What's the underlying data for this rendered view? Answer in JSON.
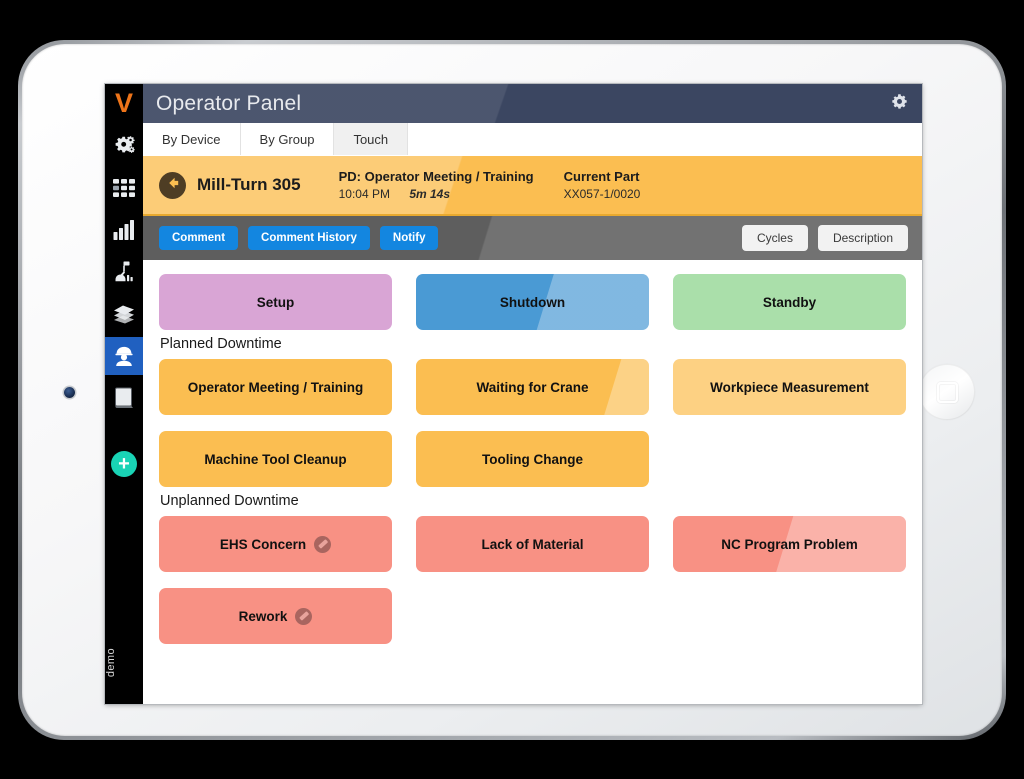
{
  "device": {
    "home_button_icon": "home-square-icon",
    "camera_icon": "front-camera-dot"
  },
  "sidebar": {
    "logo_text": "V",
    "items": [
      {
        "icon": "gears-icon",
        "name": "settings-gears",
        "active": false
      },
      {
        "icon": "grid-icon",
        "name": "dashboard-grid",
        "active": false
      },
      {
        "icon": "bar-chart-icon",
        "name": "analytics-chart",
        "active": false
      },
      {
        "icon": "robot-icon",
        "name": "machines-robot",
        "active": false
      },
      {
        "icon": "layers-icon",
        "name": "layers",
        "active": false
      },
      {
        "icon": "worker-icon",
        "name": "operator-worker",
        "active": true
      },
      {
        "icon": "book-icon",
        "name": "manual-book",
        "active": false
      }
    ],
    "add_button_label": "+",
    "add_button_icon": "plus-icon",
    "add_button_color": "#19d3b5",
    "footer_label": "demo"
  },
  "titlebar": {
    "title": "Operator Panel",
    "gear_icon": "gear-icon",
    "background": "#3b4661"
  },
  "tabs": [
    {
      "label": "By Device",
      "active": false
    },
    {
      "label": "By Group",
      "active": false
    },
    {
      "label": "Touch",
      "active": true
    }
  ],
  "status": {
    "back_icon": "arrow-left-circle-icon",
    "machine_name": "Mill-Turn 305",
    "state_label": "PD: Operator Meeting / Training",
    "state_time": "10:04 PM",
    "state_duration": "5m 14s",
    "part_label": "Current Part",
    "part_value": "XX057-1/0020",
    "background": "#fbbe51"
  },
  "actionbar": {
    "background": "#5e5e5e",
    "left_buttons": [
      {
        "label": "Comment"
      },
      {
        "label": "Comment History"
      },
      {
        "label": "Notify"
      }
    ],
    "right_buttons": [
      {
        "label": "Cycles"
      },
      {
        "label": "Description"
      }
    ],
    "blue": "#1386e0"
  },
  "content": {
    "top_row": [
      {
        "label": "Setup",
        "color": "#d9a5d5",
        "glare": "none"
      },
      {
        "label": "Shutdown",
        "color": "#4a9ad4",
        "glare": "right"
      },
      {
        "label": "Standby",
        "color": "#aadfaa",
        "glare": "none"
      }
    ],
    "planned_title": "Planned Downtime",
    "planned": [
      {
        "label": "Operator Meeting / Training",
        "color": "#fbbe51",
        "glare": "none"
      },
      {
        "label": "Waiting for Crane",
        "color": "#fbbe51",
        "glare": "corner"
      },
      {
        "label": "Workpiece Measurement",
        "color": "#fdd183",
        "glare": "none"
      },
      {
        "label": "Machine Tool Cleanup",
        "color": "#fbbe51",
        "glare": "none"
      },
      {
        "label": "Tooling Change",
        "color": "#fbbe51",
        "glare": "none"
      }
    ],
    "unplanned_title": "Unplanned Downtime",
    "unplanned": [
      {
        "label": "EHS Concern",
        "color": "#f89184",
        "glare": "none",
        "badge": "note-badge-icon"
      },
      {
        "label": "Lack of Material",
        "color": "#f89184",
        "glare": "none",
        "badge": null
      },
      {
        "label": "NC Program Problem",
        "color": "#f89184",
        "glare": "right",
        "badge": null
      },
      {
        "label": "Rework",
        "color": "#f89184",
        "glare": "none",
        "badge": "note-badge-icon"
      }
    ]
  }
}
